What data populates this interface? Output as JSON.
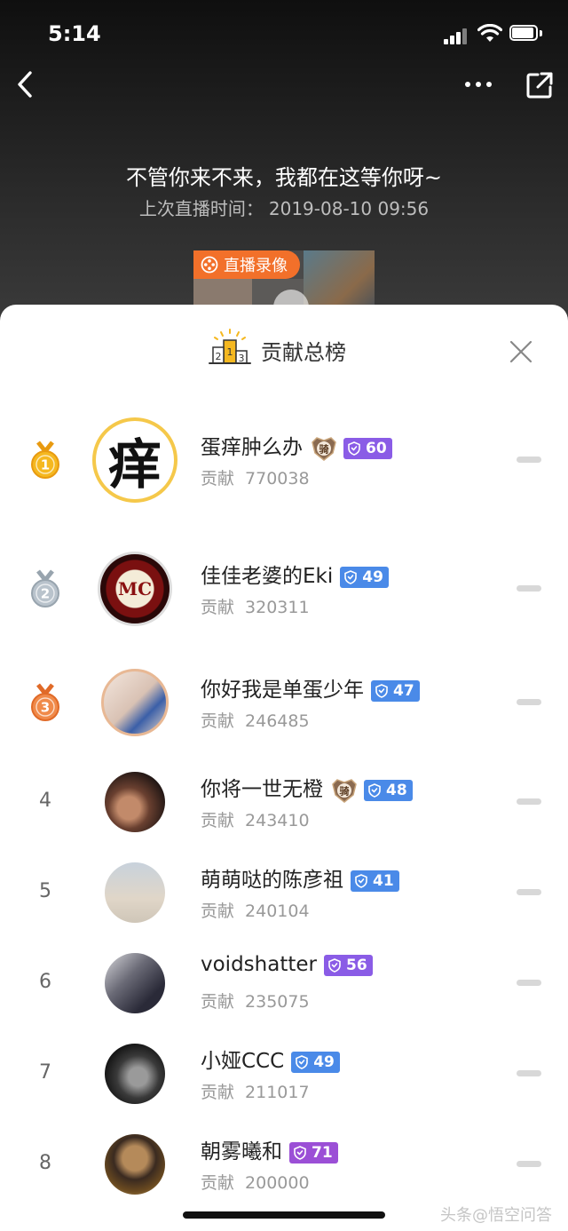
{
  "status_bar": {
    "time": "5:14"
  },
  "header": {
    "live_title": "不管你来不来，我都在这等你呀~",
    "last_live_label": "上次直播时间：",
    "last_live_time": "2019-08-10 09:56",
    "replay_badge": "直播录像"
  },
  "sheet": {
    "title": "贡献总榜",
    "contribution_label": "贡献",
    "avatar_chars": {
      "rank1": "痒",
      "rank2": "MC"
    },
    "rows": [
      {
        "rank": "1",
        "name": "蛋痒肿么办",
        "knight": "骑",
        "level": "60",
        "level_color": "#8a5ce6",
        "score": "770038"
      },
      {
        "rank": "2",
        "name": "佳佳老婆的Eki",
        "level": "49",
        "level_color": "#4a8ae8",
        "score": "320311"
      },
      {
        "rank": "3",
        "name": "你好我是单蛋少年",
        "level": "47",
        "level_color": "#4a8ae8",
        "score": "246485"
      },
      {
        "rank": "4",
        "name": "你将一世无橙",
        "knight": "骑",
        "level": "48",
        "level_color": "#4a8ae8",
        "score": "243410"
      },
      {
        "rank": "5",
        "name": "萌萌哒的陈彦祖",
        "level": "41",
        "level_color": "#4a8ae8",
        "score": "240104"
      },
      {
        "rank": "6",
        "name": "voidshatter",
        "level": "56",
        "level_color": "#8a5ce6",
        "score": "235075"
      },
      {
        "rank": "7",
        "name": "小娅CCC",
        "level": "49",
        "level_color": "#4a8ae8",
        "score": "211017"
      },
      {
        "rank": "8",
        "name": "朝雾曦和",
        "level": "71",
        "level_color": "#9b4fd6",
        "score": "200000"
      }
    ]
  },
  "watermark": "头条@悟空问答",
  "colors": {
    "accent_orange": "#f2702a",
    "gold": "#f5b820",
    "silver": "#b9c3cc",
    "bronze": "#f08a4a"
  }
}
